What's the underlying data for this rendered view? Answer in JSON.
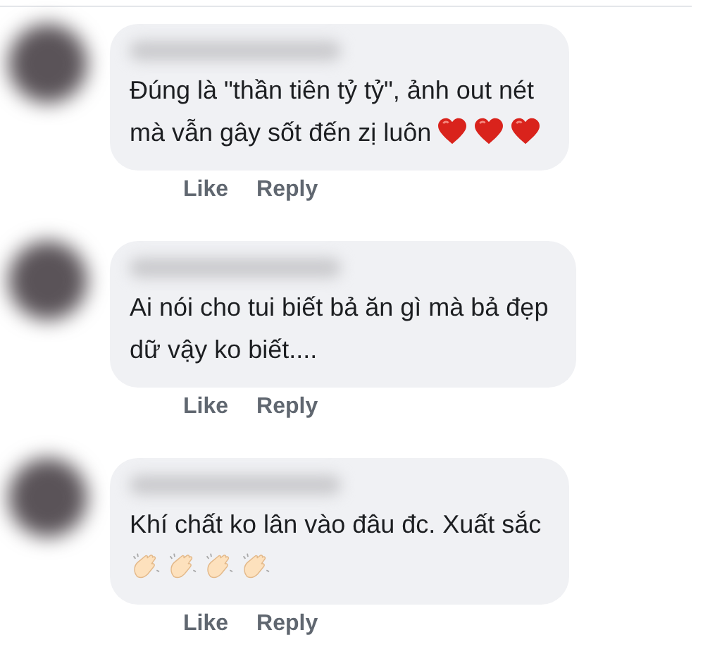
{
  "comments": [
    {
      "lines": [
        "Đúng là \"thần tiên tỷ tỷ\", ảnh out nét",
        "mà vẫn gây sốt đến zị luôn"
      ],
      "emojis": [
        {
          "kind": "heart"
        },
        {
          "kind": "heart"
        },
        {
          "kind": "heart"
        }
      ],
      "actions": [
        "Like",
        "Reply"
      ]
    },
    {
      "lines": [
        "Ai nói cho tui biết bả ăn gì mà bả đẹp",
        "dữ vậy ko biết...."
      ],
      "actions": [
        "Like",
        "Reply"
      ]
    },
    {
      "lines": [
        "Khí chất ko lân vào đâu đc. Xuất sắc"
      ],
      "emoji_line": true,
      "emojis": [
        {
          "kind": "clap"
        },
        {
          "kind": "clap"
        },
        {
          "kind": "clap"
        },
        {
          "kind": "clap"
        }
      ],
      "actions": [
        "Like",
        "Reply"
      ]
    }
  ]
}
